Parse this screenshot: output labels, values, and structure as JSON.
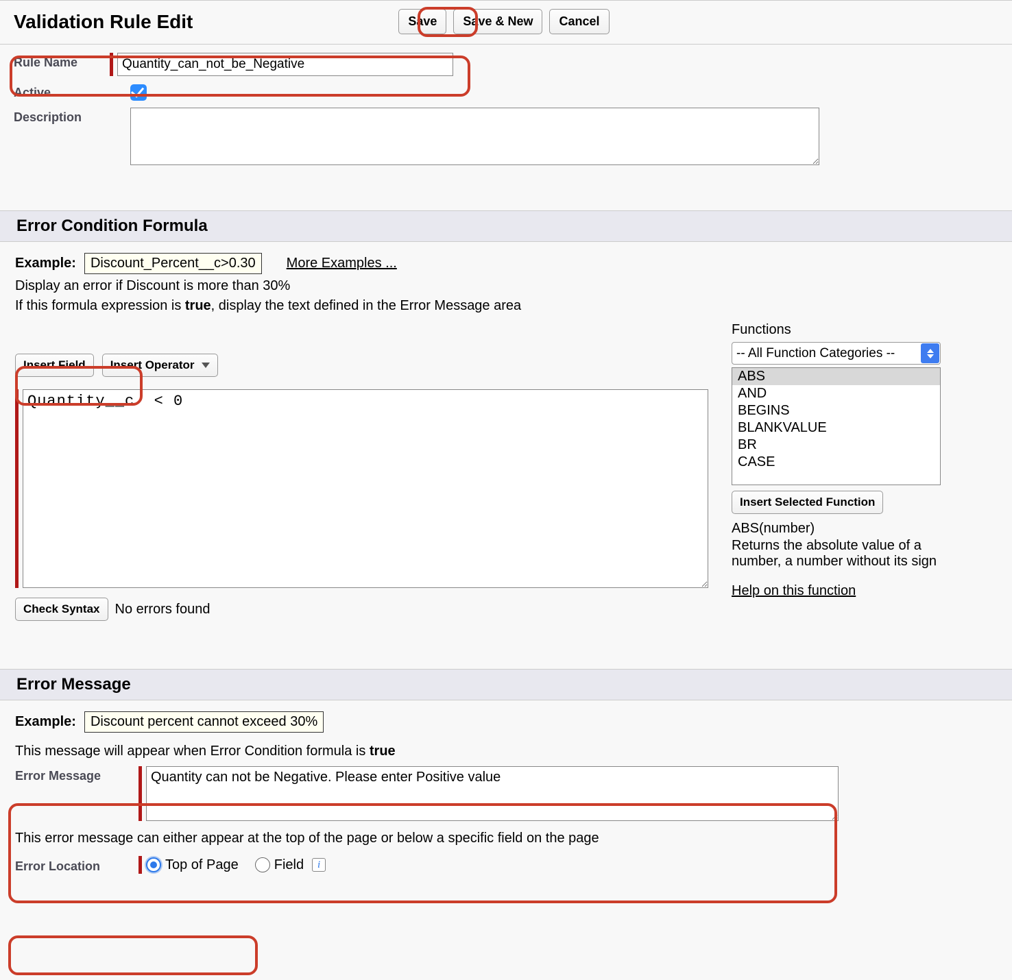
{
  "header": {
    "title": "Validation Rule Edit",
    "buttons": {
      "save": "Save",
      "save_new": "Save & New",
      "cancel": "Cancel"
    }
  },
  "form": {
    "rule_name_label": "Rule Name",
    "rule_name_value": "Quantity_can_not_be_Negative",
    "active_label": "Active",
    "active_checked": true,
    "description_label": "Description",
    "description_value": ""
  },
  "formula_section": {
    "title": "Error Condition Formula",
    "example_label": "Example:",
    "example_value": "Discount_Percent__c>0.30",
    "more_examples": "More Examples ...",
    "display_text": "Display an error if Discount is more than 30%",
    "if_true_pre": "If this formula expression is ",
    "if_true_bold": "true",
    "if_true_post": ", display the text defined in the Error Message area",
    "insert_field": "Insert Field",
    "insert_operator": "Insert Operator",
    "formula_value": "Quantity__c  < 0",
    "check_syntax": "Check Syntax",
    "check_result": "No errors found"
  },
  "functions": {
    "label": "Functions",
    "category": "-- All Function Categories --",
    "list": [
      "ABS",
      "AND",
      "BEGINS",
      "BLANKVALUE",
      "BR",
      "CASE"
    ],
    "insert_btn": "Insert Selected Function",
    "signature": "ABS(number)",
    "description": "Returns the absolute value of a number, a number without its sign",
    "help_link": "Help on this function"
  },
  "error_section": {
    "title": "Error Message",
    "example_label": "Example:",
    "example_value": "Discount percent cannot exceed 30%",
    "appear_pre": "This message will appear when Error Condition formula is ",
    "appear_bold": "true",
    "error_message_label": "Error Message",
    "error_message_value": "Quantity can not be Negative. Please enter Positive value",
    "location_hint": "This error message can either appear at the top of the page or below a specific field on the page",
    "location_label": "Error Location",
    "radio_top": "Top of Page",
    "radio_field": "Field"
  }
}
